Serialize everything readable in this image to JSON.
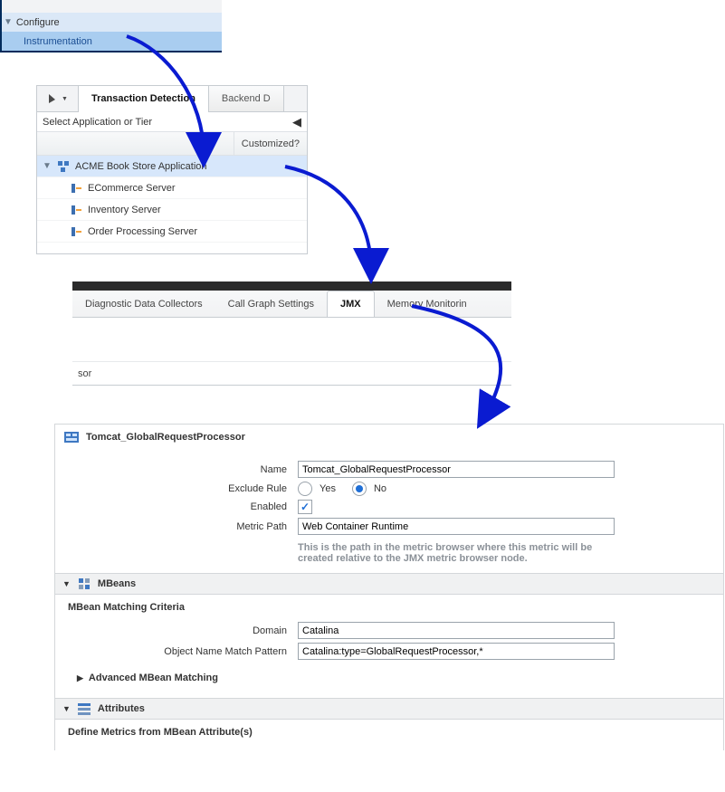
{
  "nav": {
    "parent": "Configure",
    "child": "Instrumentation"
  },
  "panel2": {
    "tab1": "Transaction Detection",
    "tab2": "Backend D",
    "selectLabel": "Select Application or Tier",
    "colCustomized": "Customized?",
    "appName": "ACME Book Store Application",
    "servers": [
      "ECommerce Server",
      "Inventory Server",
      "Order Processing Server"
    ]
  },
  "panel3": {
    "tabs": {
      "diag": "Diagnostic Data Collectors",
      "callgraph": "Call Graph Settings",
      "jmx": "JMX",
      "memmon": "Memory Monitorin"
    },
    "sor": "sor"
  },
  "panel4": {
    "title": "Tomcat_GlobalRequestProcessor",
    "labels": {
      "name": "Name",
      "exclude": "Exclude Rule",
      "yes": "Yes",
      "no": "No",
      "enabled": "Enabled",
      "metricPath": "Metric Path",
      "help": "This is the path in the metric browser where this metric will be created relative to the JMX metric browser node.",
      "mbeansHdr": "MBeans",
      "mbCriteria": "MBean Matching Criteria",
      "domain": "Domain",
      "pattern": "Object Name Match Pattern",
      "advanced": "Advanced MBean Matching",
      "attrsHdr": "Attributes",
      "defineMetrics": "Define Metrics from MBean Attribute(s)"
    },
    "values": {
      "name": "Tomcat_GlobalRequestProcessor",
      "excludeRule": "No",
      "enabled": true,
      "metricPath": "Web Container Runtime",
      "domain": "Catalina",
      "pattern": "Catalina:type=GlobalRequestProcessor,*"
    }
  }
}
